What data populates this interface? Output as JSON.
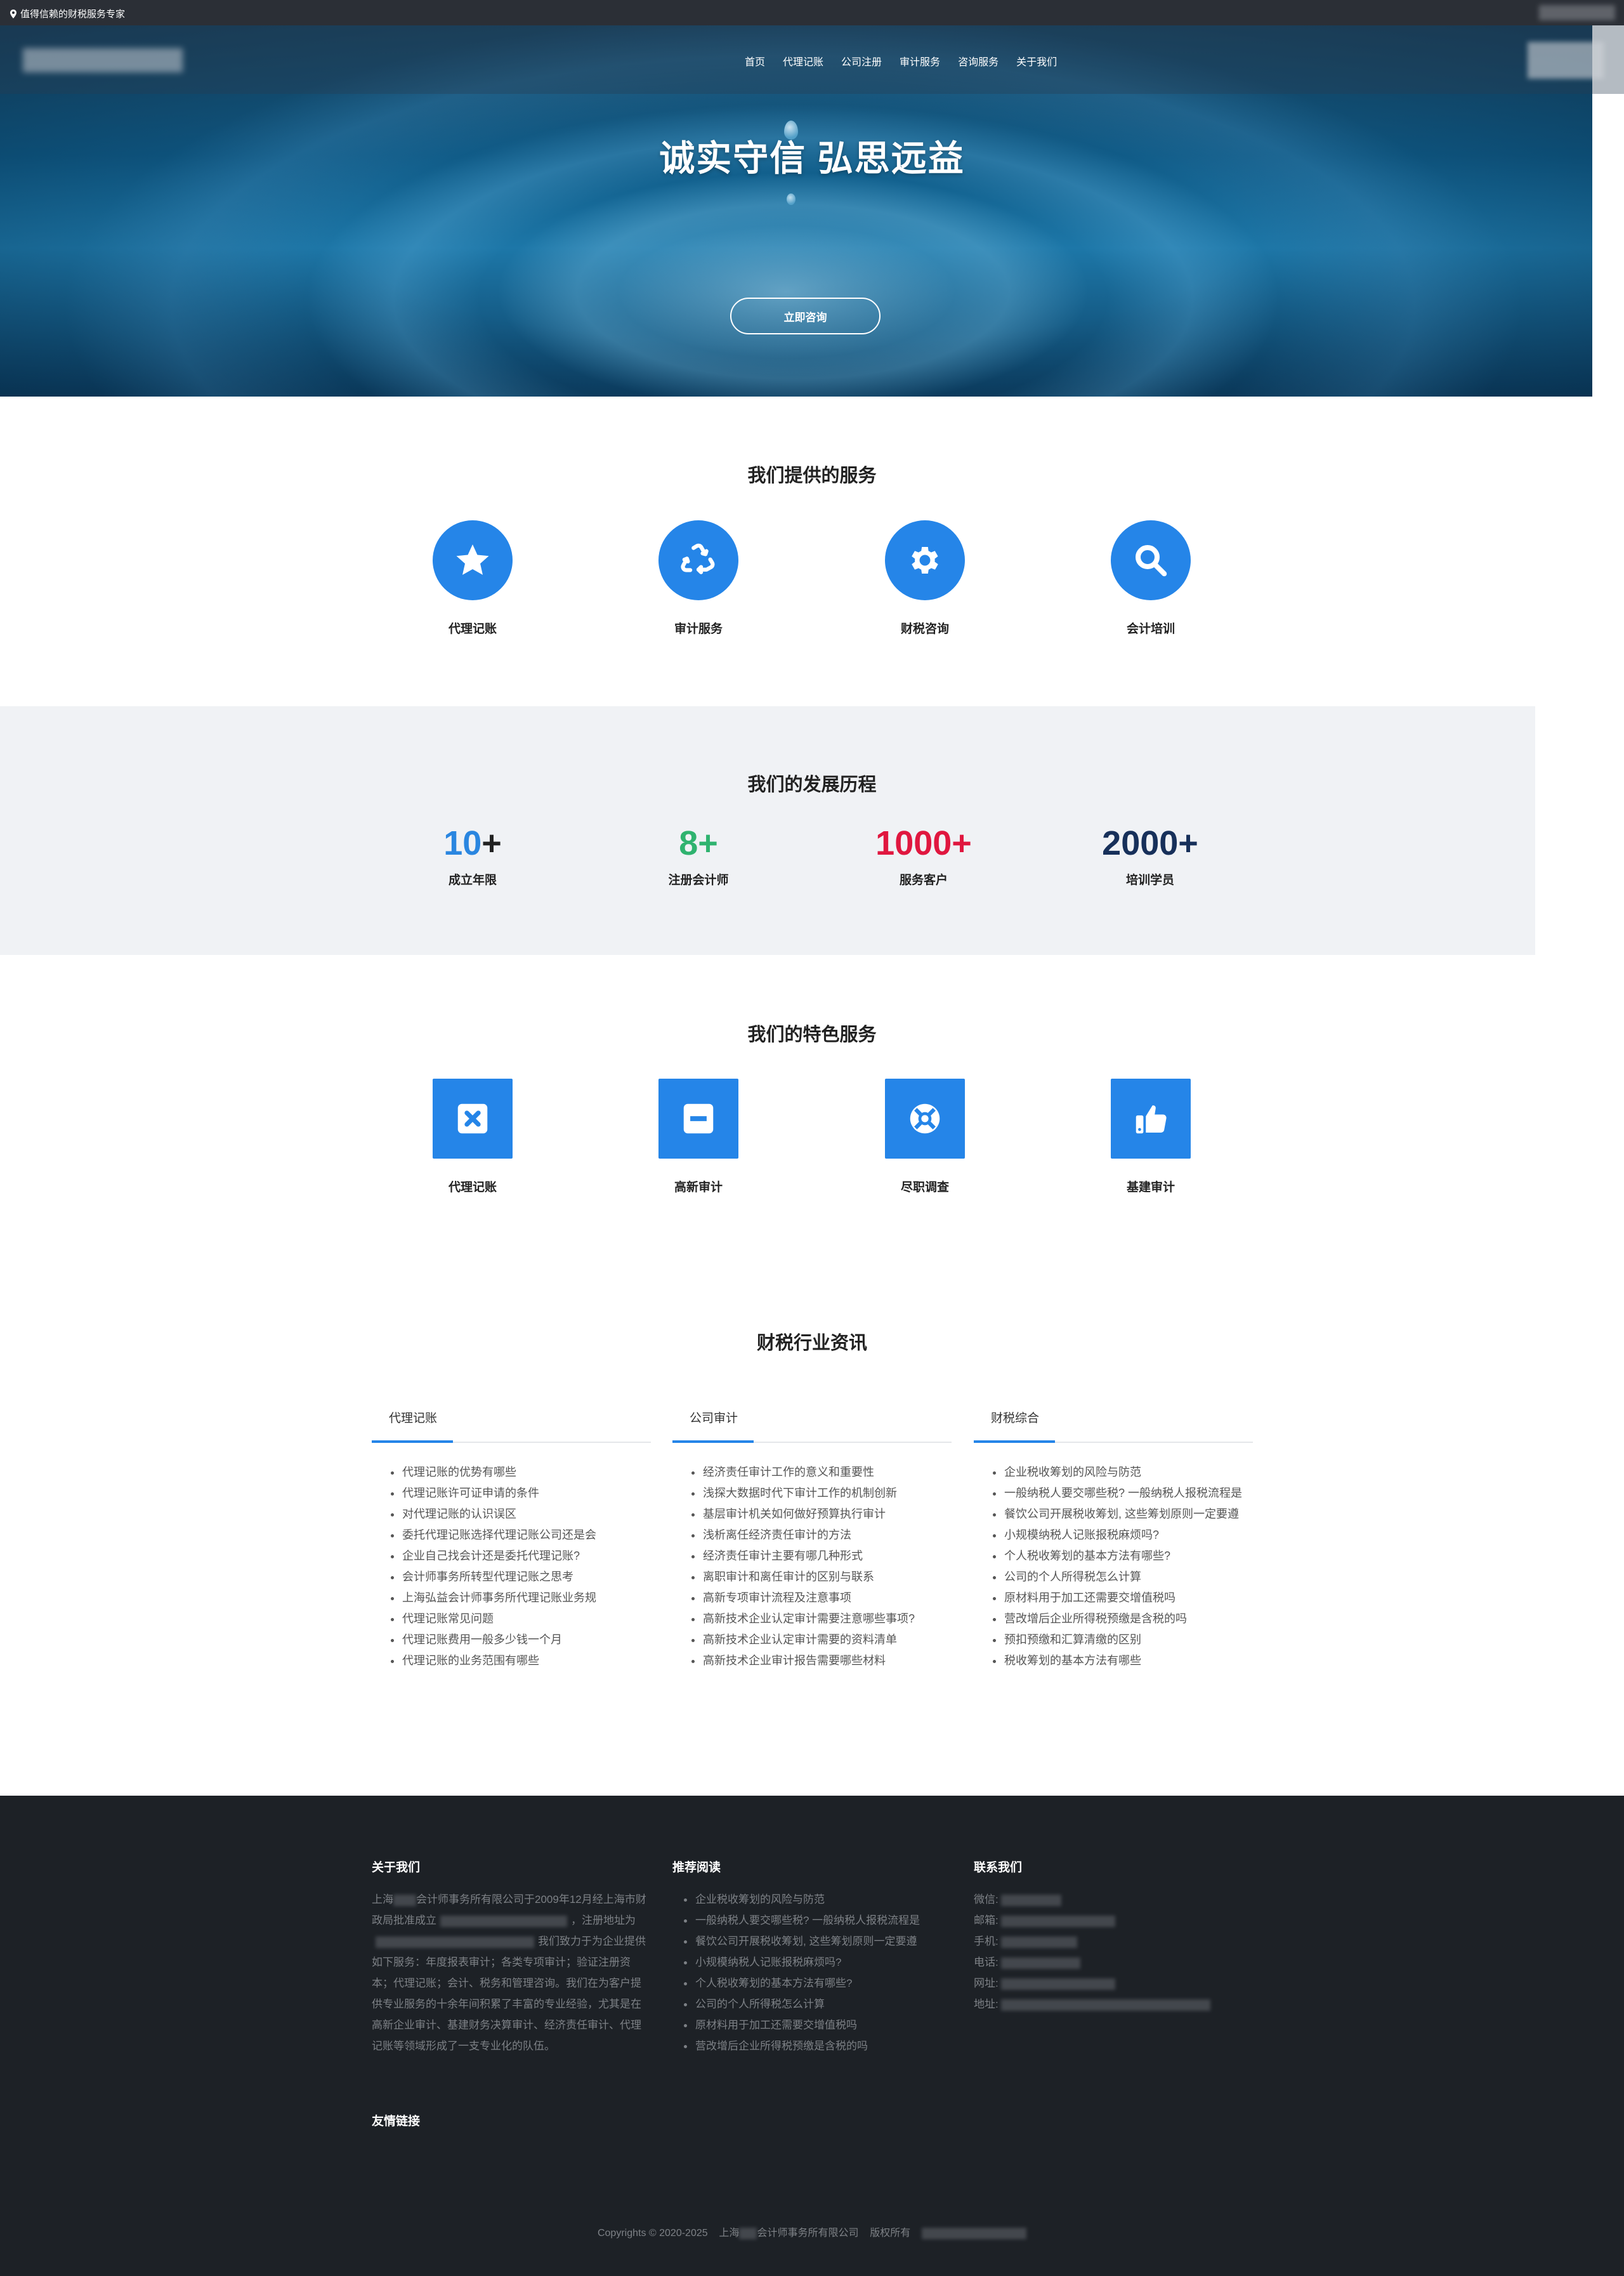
{
  "topbar": {
    "tagline": "值得信赖的财税服务专家"
  },
  "nav": {
    "items": [
      "首页",
      "代理记账",
      "公司注册",
      "审计服务",
      "咨询服务",
      "关于我们"
    ]
  },
  "hero": {
    "title": "诚实守信 弘思远益",
    "cta": "立即咨询"
  },
  "services": {
    "title": "我们提供的服务",
    "items": [
      {
        "label": "代理记账",
        "icon": "star-icon"
      },
      {
        "label": "审计服务",
        "icon": "recycle-icon"
      },
      {
        "label": "财税咨询",
        "icon": "gear-icon"
      },
      {
        "label": "会计培训",
        "icon": "search-icon"
      }
    ]
  },
  "history": {
    "title": "我们的发展历程",
    "stats": [
      {
        "value": "10",
        "suffix": "+",
        "label": "成立年限",
        "color": "#2a86e0"
      },
      {
        "value": "8",
        "suffix": "+",
        "label": "注册会计师",
        "color": "#2fb36f"
      },
      {
        "value": "1000",
        "suffix": "+",
        "label": "服务客户",
        "color": "#e0173f"
      },
      {
        "value": "2000",
        "suffix": "+",
        "label": "培训学员",
        "color": "#17305a"
      }
    ]
  },
  "featured": {
    "title": "我们的特色服务",
    "items": [
      {
        "label": "代理记账",
        "icon": "close-box-icon"
      },
      {
        "label": "高新审计",
        "icon": "minus-box-icon"
      },
      {
        "label": "尽职调查",
        "icon": "lifebuoy-icon"
      },
      {
        "label": "基建审计",
        "icon": "thumbs-up-icon"
      }
    ]
  },
  "news": {
    "title": "财税行业资讯",
    "columns": [
      {
        "tab": "代理记账",
        "items": [
          "代理记账的优势有哪些",
          "代理记账许可证申请的条件",
          "对代理记账的认识误区",
          "委托代理记账选择代理记账公司还是会",
          "企业自己找会计还是委托代理记账?",
          "会计师事务所转型代理记账之思考",
          "上海弘益会计师事务所代理记账业务规",
          "代理记账常见问题",
          "代理记账费用一般多少钱一个月",
          "代理记账的业务范围有哪些"
        ]
      },
      {
        "tab": "公司审计",
        "items": [
          "经济责任审计工作的意义和重要性",
          "浅探大数据时代下审计工作的机制创新",
          "基层审计机关如何做好预算执行审计",
          "浅析离任经济责任审计的方法",
          "经济责任审计主要有哪几种形式",
          "离职审计和离任审计的区别与联系",
          "高新专项审计流程及注意事项",
          "高新技术企业认定审计需要注意哪些事项?",
          "高新技术企业认定审计需要的资料清单",
          "高新技术企业审计报告需要哪些材料"
        ]
      },
      {
        "tab": "财税综合",
        "items": [
          "企业税收筹划的风险与防范",
          "一般纳税人要交哪些税? 一般纳税人报税流程是",
          "餐饮公司开展税收筹划, 这些筹划原则一定要遵",
          "小规模纳税人记账报税麻烦吗?",
          "个人税收筹划的基本方法有哪些?",
          "公司的个人所得税怎么计算",
          "原材料用于加工还需要交增值税吗",
          "营改增后企业所得税预缴是含税的吗",
          "预扣预缴和汇算清缴的区别",
          "税收筹划的基本方法有哪些"
        ]
      }
    ]
  },
  "footer": {
    "about": {
      "title": "关于我们",
      "p1": "上海",
      "p2": "会计师事务所有限公司于2009年12月经上海市财政局批准成立",
      "p3": "，注册地址为",
      "p4": "我们致力于为企业提供如下服务：年度报表审计；各类专项审计；验证注册资本；代理记账；会计、税务和管理咨询。我们在为客户提供专业服务的十余年间积累了丰富的专业经验，尤其是在高新企业审计、基建财务决算审计、经济责任审计、代理记账等领域形成了一支专业化的队伍。"
    },
    "reading": {
      "title": "推荐阅读",
      "items": [
        "企业税收筹划的风险与防范",
        "一般纳税人要交哪些税? 一般纳税人报税流程是",
        "餐饮公司开展税收筹划, 这些筹划原则一定要遵",
        "小规模纳税人记账报税麻烦吗?",
        "个人税收筹划的基本方法有哪些?",
        "公司的个人所得税怎么计算",
        "原材料用于加工还需要交增值税吗",
        "营改增后企业所得税预缴是含税的吗"
      ]
    },
    "contact": {
      "title": "联系我们",
      "labels": [
        "微信:",
        "邮箱:",
        "手机:",
        "电话:",
        "网址:",
        "地址:"
      ]
    },
    "links_title": "友情链接",
    "copyright_prefix": "Copyrights © 2020-2025",
    "copyright_company_a": "上海",
    "copyright_company_b": "会计师事务所有限公司",
    "copyright_rights": "版权所有"
  }
}
